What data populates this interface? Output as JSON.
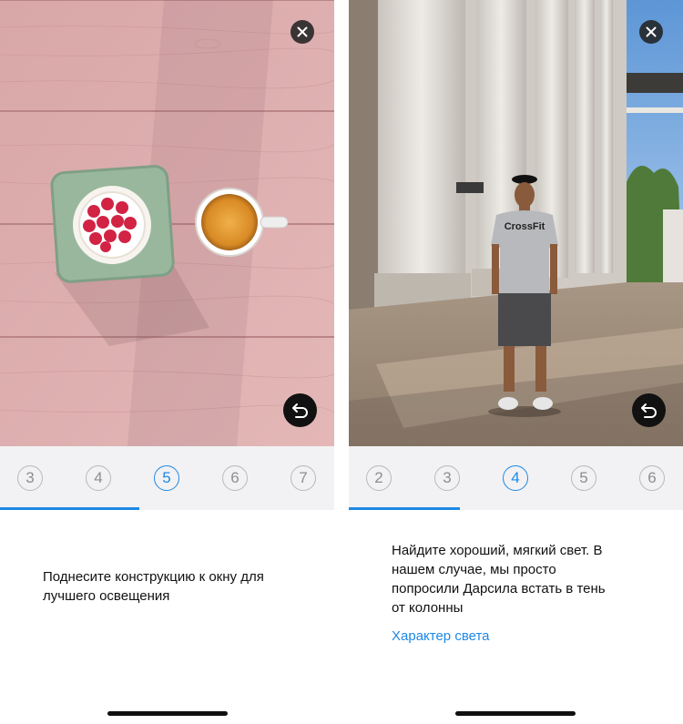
{
  "screens": [
    {
      "steps": [
        "3",
        "4",
        "5",
        "6",
        "7"
      ],
      "active_step": "5",
      "description_lines": [
        "Поднесите конструкцию к окну для",
        "лучшего освещения"
      ],
      "icons": {
        "close": "close-icon",
        "undo": "undo-icon"
      }
    },
    {
      "steps": [
        "2",
        "3",
        "4",
        "5",
        "6"
      ],
      "active_step": "4",
      "description_lines": [
        "Найдите хороший, мягкий свет. В",
        "нашем случае, мы просто",
        "попросили Дарсила встать в тень",
        "от колонны"
      ],
      "shirt_text": "CrossFit",
      "link_label": "Характер света",
      "icons": {
        "close": "close-icon",
        "undo": "undo-icon"
      }
    }
  ],
  "colors": {
    "accent": "#1e88e5",
    "inactive_step": "#b9b9bd",
    "step_bar": "#f2f2f4"
  }
}
